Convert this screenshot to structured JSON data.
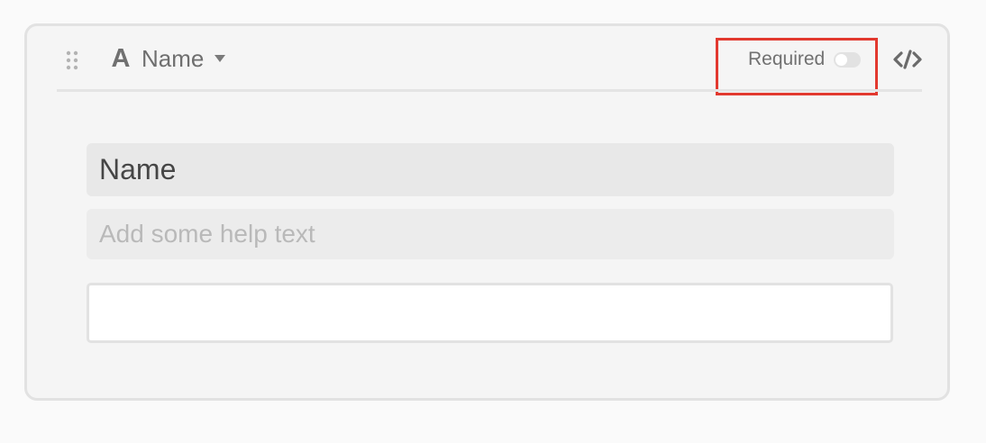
{
  "field": {
    "type_label": "Name",
    "type_icon_glyph": "A",
    "type_icon": "text-type-icon",
    "required_label": "Required",
    "required_enabled": false,
    "title": "Name",
    "help_placeholder": "Add some help text",
    "answer_value": ""
  },
  "icons": {
    "drag": "drag-handle-icon",
    "caret": "caret-down-icon",
    "code": "code-icon"
  },
  "colors": {
    "highlight": "#e2392f",
    "card_background": "#f5f5f5",
    "text_muted": "#6f6f6f"
  }
}
